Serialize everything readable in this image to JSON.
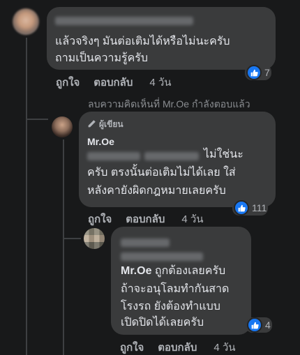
{
  "comments": [
    {
      "text_lines": [
        "แล้วจริงๆ มันต่อเติมได้หรือไม่นะครับ",
        "ถามเป็นความรู้ครับ"
      ],
      "like_count": "7",
      "actions": {
        "like": "ถูกใจ",
        "reply": "ตอบกลับ",
        "time": "4 วัน"
      }
    },
    {
      "status_note": "ลบความคิดเห็นที่ Mr.Oe กำลังตอบแล้ว",
      "author_badge": "ผู้เขียน",
      "author_name": "Mr.Oe",
      "text_lines": [
        "ไม่ใช่นะ",
        "ครับ ตรงนั้นต่อเติมไม่ได้เลย ใส่",
        "หลังคายังผิดกฎหมายเลยครับ"
      ],
      "like_count": "111",
      "actions": {
        "like": "ถูกใจ",
        "reply": "ตอบกลับ",
        "time": "4 วัน"
      }
    },
    {
      "text_lines": [
        "Mr.Oe ถูกต้องเลยครับ",
        "ถ้าจะอนุโลมทำกันสาด",
        "โรงรถ ยังต้องทำแบบ",
        "เปิดปิดได้เลยครับ"
      ],
      "mention": "Mr.Oe",
      "like_count": "4",
      "actions": {
        "like": "ถูกใจ",
        "reply": "ตอบกลับ",
        "time": "4 วัน"
      }
    }
  ],
  "colors": {
    "background": "#18191a",
    "bubble": "#3a3b3c",
    "like_blue": "#1877f2",
    "secondary_text": "#b0b3b8"
  },
  "icons": {
    "author_badge": "pencil-icon",
    "reaction": "thumbs-up-icon"
  }
}
